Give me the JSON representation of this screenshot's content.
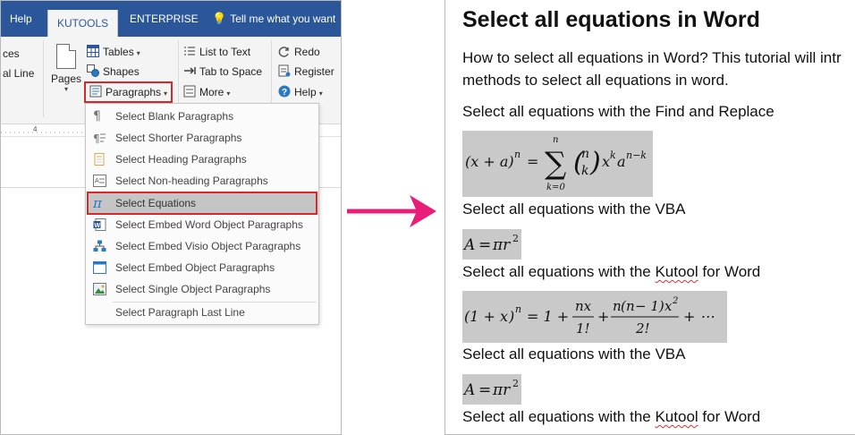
{
  "ribbon": {
    "tabs": {
      "help": "Help",
      "kutools": "KUTOOLS",
      "enterprise": "ENTERPRISE",
      "tellme": "Tell me what you want"
    },
    "items": {
      "ces": "ces",
      "al_line": "al Line",
      "pages": "Pages",
      "tables": "Tables",
      "shapes": "Shapes",
      "paragraphs": "Paragraphs",
      "list_to_text": "List to Text",
      "tab_to_space": "Tab to Space",
      "more": "More",
      "redo": "Redo",
      "register": "Register",
      "help": "Help"
    },
    "ruler_mark": "4"
  },
  "menu": {
    "items": [
      {
        "label": "Select Blank Paragraphs",
        "icon": "pilcrow-icon"
      },
      {
        "label": "Select Shorter Paragraphs",
        "icon": "short-paragraph-icon"
      },
      {
        "label": "Select Heading Paragraphs",
        "icon": "heading-page-icon"
      },
      {
        "label": "Select Non-heading Paragraphs",
        "icon": "non-heading-icon"
      },
      {
        "label": "Select Equations",
        "icon": "pi-icon",
        "selected": true
      },
      {
        "label": "Select Embed Word Object Paragraphs",
        "icon": "word-object-icon"
      },
      {
        "label": "Select Embed Visio Object Paragraphs",
        "icon": "visio-object-icon"
      },
      {
        "label": "Select Embed Object Paragraphs",
        "icon": "object-frame-icon"
      },
      {
        "label": "Select Single Object Paragraphs",
        "icon": "image-object-icon"
      },
      {
        "label": "Select Paragraph Last Line",
        "icon": ""
      }
    ]
  },
  "doc": {
    "title": "Select all equations in Word",
    "intro_line1": "How to select all equations in Word? This tutorial will intr",
    "intro_line2": "methods to select all equations in word.",
    "p_find_replace": "Select all equations with the Find and Replace",
    "p_vba_1": "Select all equations with the VBA",
    "p_kutool_prefix_1": "Select all equations with the ",
    "p_kutool_word_1": "Kutool",
    "p_kutool_suffix_1": " for Word",
    "p_vba_2": "Select all equations with the VBA",
    "p_kutool_prefix_2": "Select all equations with the ",
    "p_kutool_word_2": "Kutool",
    "p_kutool_suffix_2": " for Word"
  },
  "colors": {
    "tab_bar": "#2b579a",
    "highlight": "#d9262b",
    "arrow": "#e91e7a",
    "equation_bg": "#c9c9c9"
  }
}
